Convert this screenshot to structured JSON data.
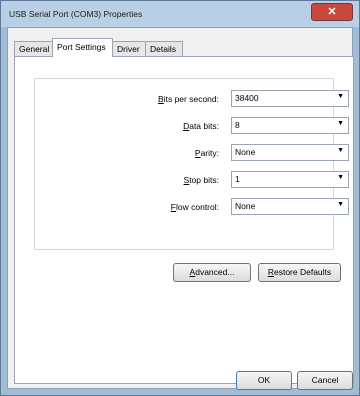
{
  "window": {
    "title": "USB Serial Port (COM3) Properties",
    "close_symbol": "✕"
  },
  "tabs": [
    {
      "label": "General"
    },
    {
      "label": "Port Settings"
    },
    {
      "label": "Driver"
    },
    {
      "label": "Details"
    }
  ],
  "settings": [
    {
      "accel": "B",
      "rest": "its per second:",
      "value": "38400"
    },
    {
      "accel": "D",
      "rest": "ata bits:",
      "value": "8"
    },
    {
      "accel": "P",
      "rest": "arity:",
      "value": "None"
    },
    {
      "accel": "S",
      "rest": "top bits:",
      "value": "1"
    },
    {
      "accel": "F",
      "rest": "low control:",
      "value": "None"
    }
  ],
  "buttons": {
    "advanced": {
      "accel": "A",
      "rest": "dvanced..."
    },
    "restore": {
      "accel": "R",
      "rest": "estore Defaults"
    },
    "ok": "OK",
    "cancel": "Cancel"
  },
  "icons": {
    "dropdown": "▼"
  }
}
